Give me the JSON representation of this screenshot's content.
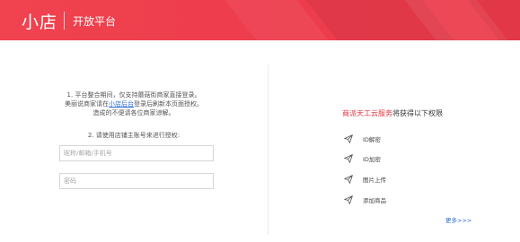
{
  "header": {
    "logo": "小店",
    "platform": "开放平台"
  },
  "login": {
    "notice_line1": "1. 平台整合期间，仅支持蘑菇街商家直接登录。",
    "notice_line2_pre": "美丽说商家请在",
    "notice_link": "小店后台",
    "notice_line2_post": "登录后刷新本页面授权。",
    "notice_line3": "造成的不便请各位商家谅解。",
    "auth_hint": "2. 请使用店铺主账号来进行授权:",
    "account_placeholder": "昵称/邮箱/手机号",
    "password_placeholder": "密码"
  },
  "permissions": {
    "brand": "商派天工云服务",
    "title_suffix": "将获得以下权限",
    "items": [
      "ID解密",
      "ID加密",
      "图片上传",
      "添加商品"
    ],
    "more": "更多>>>"
  },
  "colors": {
    "brand_red": "#ee3e4d",
    "link_blue": "#2a6dd6"
  }
}
